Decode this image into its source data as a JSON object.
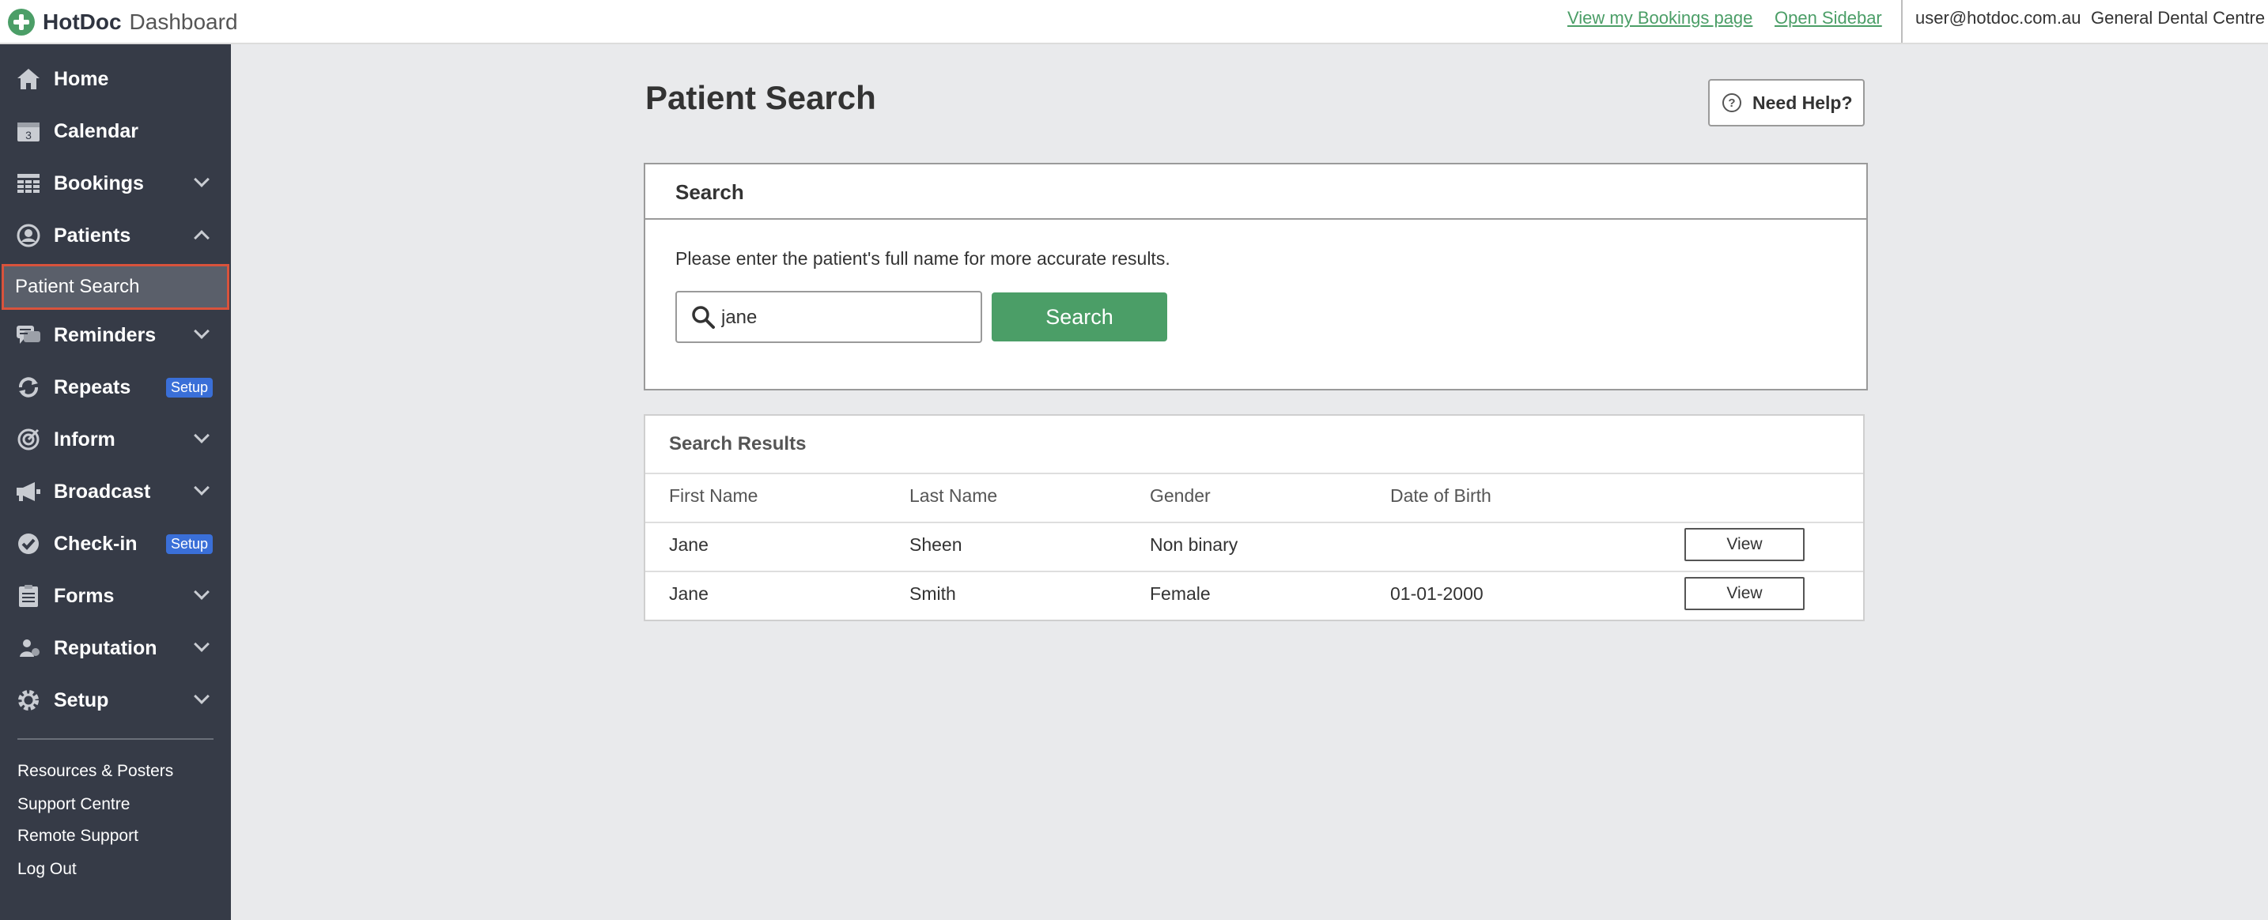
{
  "header": {
    "brand_name": "HotDoc",
    "brand_sub": "Dashboard",
    "bookings_link": "View my Bookings page",
    "sidebar_link": "Open Sidebar",
    "user_email": "user@hotdoc.com.au",
    "practice_name": "General Dental Centre"
  },
  "sidebar": {
    "items": [
      {
        "label": "Home",
        "icon": "home-icon"
      },
      {
        "label": "Calendar",
        "icon": "calendar-icon"
      },
      {
        "label": "Bookings",
        "icon": "bookings-icon"
      },
      {
        "label": "Patients",
        "icon": "patients-icon"
      },
      {
        "label": "Reminders",
        "icon": "reminders-icon"
      },
      {
        "label": "Repeats",
        "icon": "repeats-icon",
        "badge": "Setup"
      },
      {
        "label": "Inform",
        "icon": "inform-icon"
      },
      {
        "label": "Broadcast",
        "icon": "broadcast-icon"
      },
      {
        "label": "Check-in",
        "icon": "checkin-icon",
        "badge": "Setup"
      },
      {
        "label": "Forms",
        "icon": "forms-icon"
      },
      {
        "label": "Reputation",
        "icon": "reputation-icon"
      },
      {
        "label": "Setup",
        "icon": "setup-icon"
      }
    ],
    "calendar_day": "3",
    "active_subitem": "Patient Search",
    "footer_links": [
      "Resources & Posters",
      "Support Centre",
      "Remote Support",
      "Log Out"
    ]
  },
  "main": {
    "title": "Patient Search",
    "help_label": "Need Help?",
    "search_card": {
      "title": "Search",
      "hint": "Please enter the patient's full name for more accurate results.",
      "input_value": "jane",
      "button_label": "Search"
    },
    "results": {
      "title": "Search Results",
      "columns": [
        "First Name",
        "Last Name",
        "Gender",
        "Date of Birth"
      ],
      "rows": [
        {
          "first_name": "Jane",
          "last_name": "Sheen",
          "gender": "Non binary",
          "dob": "",
          "action": "View"
        },
        {
          "first_name": "Jane",
          "last_name": "Smith",
          "gender": "Female",
          "dob": "01-01-2000",
          "action": "View"
        }
      ]
    }
  },
  "colors": {
    "accent_green": "#4b9e67",
    "sidebar_bg": "#363b47",
    "badge_blue": "#3a6fd8",
    "active_border": "#d9533c"
  }
}
